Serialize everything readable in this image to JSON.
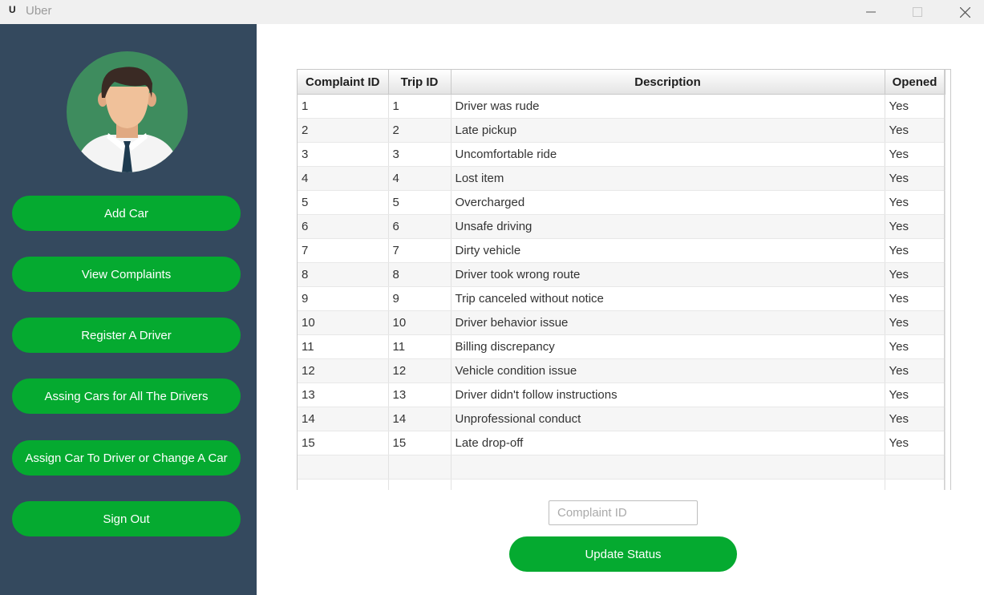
{
  "window": {
    "title": "Uber",
    "icon": "U"
  },
  "sidebar": {
    "avatar_icon": "user-avatar-icon",
    "buttons": [
      {
        "label": "Add Car"
      },
      {
        "label": "View Complaints"
      },
      {
        "label": "Register A Driver"
      },
      {
        "label": "Assing Cars for All The Drivers"
      },
      {
        "label": "Assign Car To Driver or Change A Car"
      },
      {
        "label": "Sign Out"
      }
    ]
  },
  "table": {
    "headers": [
      "Complaint ID",
      "Trip ID",
      "Description",
      "Opened"
    ],
    "rows": [
      [
        "1",
        "1",
        "Driver was rude",
        "Yes"
      ],
      [
        "2",
        "2",
        "Late pickup",
        "Yes"
      ],
      [
        "3",
        "3",
        "Uncomfortable ride",
        "Yes"
      ],
      [
        "4",
        "4",
        "Lost item",
        "Yes"
      ],
      [
        "5",
        "5",
        "Overcharged",
        "Yes"
      ],
      [
        "6",
        "6",
        "Unsafe driving",
        "Yes"
      ],
      [
        "7",
        "7",
        "Dirty vehicle",
        "Yes"
      ],
      [
        "8",
        "8",
        "Driver took wrong route",
        "Yes"
      ],
      [
        "9",
        "9",
        "Trip canceled without notice",
        "Yes"
      ],
      [
        "10",
        "10",
        "Driver behavior issue",
        "Yes"
      ],
      [
        "11",
        "11",
        "Billing discrepancy",
        "Yes"
      ],
      [
        "12",
        "12",
        "Vehicle condition issue",
        "Yes"
      ],
      [
        "13",
        "13",
        "Driver didn't follow instructions",
        "Yes"
      ],
      [
        "14",
        "14",
        "Unprofessional conduct",
        "Yes"
      ],
      [
        "15",
        "15",
        "Late drop-off",
        "Yes"
      ]
    ]
  },
  "form": {
    "complaint_id_placeholder": "Complaint ID",
    "complaint_id_value": "",
    "update_label": "Update Status"
  },
  "colors": {
    "sidebar": "#34495e",
    "accent": "#05aa30"
  }
}
